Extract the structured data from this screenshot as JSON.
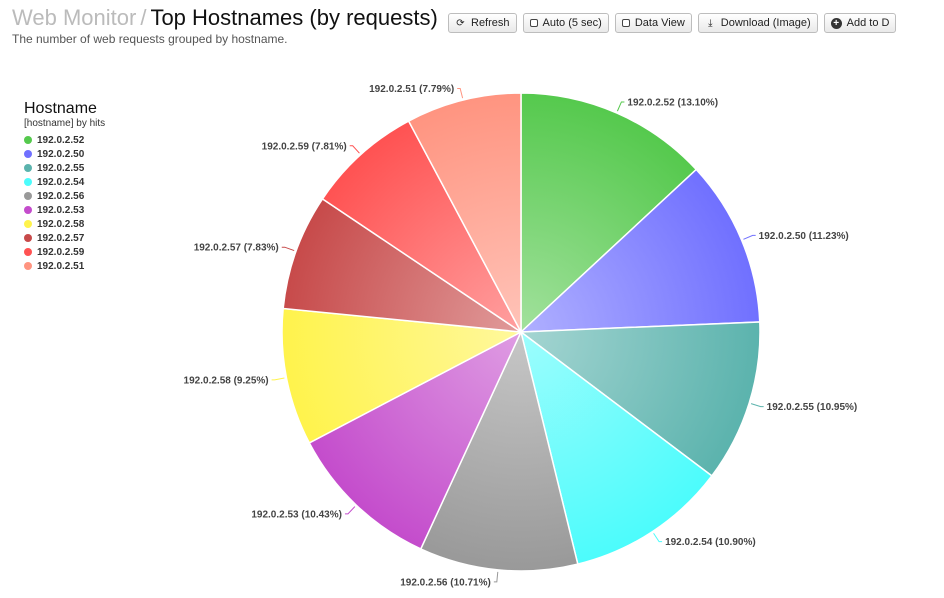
{
  "header": {
    "breadcrumb": "Web Monitor",
    "separator": "/",
    "title": "Top Hostnames (by requests)",
    "subtitle": "The number of web requests grouped by hostname."
  },
  "toolbar": {
    "refresh": "Refresh",
    "auto": "Auto (5 sec)",
    "data_view": "Data View",
    "download": "Download (Image)",
    "add": "Add to D"
  },
  "legend": {
    "title": "Hostname",
    "subtitle": "[hostname] by hits"
  },
  "chart_data": {
    "type": "pie",
    "title": "Hostname",
    "subtitle": "[hostname] by hits",
    "legend_position": "left",
    "slices": [
      {
        "label": "192.0.2.52",
        "value": 13.1,
        "color": "#55c94d"
      },
      {
        "label": "192.0.2.50",
        "value": 11.23,
        "color": "#7070ff"
      },
      {
        "label": "192.0.2.55",
        "value": 10.95,
        "color": "#5bb3ad"
      },
      {
        "label": "192.0.2.54",
        "value": 10.9,
        "color": "#4cfcfc"
      },
      {
        "label": "192.0.2.56",
        "value": 10.71,
        "color": "#999999"
      },
      {
        "label": "192.0.2.53",
        "value": 10.43,
        "color": "#c44ccc"
      },
      {
        "label": "192.0.2.58",
        "value": 9.25,
        "color": "#fff34c"
      },
      {
        "label": "192.0.2.57",
        "value": 7.83,
        "color": "#c74a4a"
      },
      {
        "label": "192.0.2.59",
        "value": 7.81,
        "color": "#ff5252"
      },
      {
        "label": "192.0.2.51",
        "value": 7.79,
        "color": "#ff9480"
      }
    ]
  }
}
